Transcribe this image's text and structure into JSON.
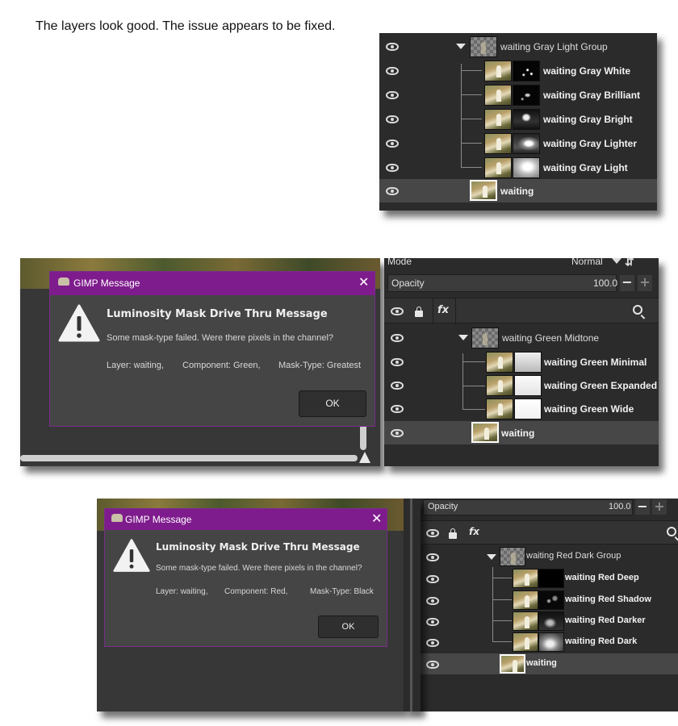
{
  "caption": "The layers look good. The issue appears to be fixed.",
  "panel1": {
    "layers": [
      {
        "name": "waiting Gray Light Group"
      },
      {
        "name": "waiting Gray White"
      },
      {
        "name": "waiting Gray Brilliant"
      },
      {
        "name": "waiting Gray Bright"
      },
      {
        "name": "waiting Gray Lighter"
      },
      {
        "name": "waiting Gray Light"
      },
      {
        "name": "waiting"
      }
    ]
  },
  "panel2": {
    "mode_label": "Mode",
    "mode_value": "Normal",
    "opacity_label": "Opacity",
    "opacity_value": "100.0",
    "fx_label": "fx",
    "layers": [
      {
        "name": "waiting Green Midtone"
      },
      {
        "name": "waiting Green Minimal"
      },
      {
        "name": "waiting Green Expanded"
      },
      {
        "name": "waiting Green Wide"
      },
      {
        "name": "waiting"
      }
    ]
  },
  "dialog1": {
    "title": "GIMP Message",
    "heading": "Luminosity Mask Drive Thru Message",
    "message": "Some mask-type failed. Were there pixels in the channel?",
    "layer": "Layer: waiting,",
    "component": "Component: Green,",
    "mask_type": "Mask-Type: Greatest",
    "ok_label": "OK"
  },
  "panel3": {
    "opacity_label": "Opacity",
    "opacity_value": "100.0",
    "fx_label": "fx",
    "layers": [
      {
        "name": "waiting Red Dark Group"
      },
      {
        "name": "waiting Red Deep"
      },
      {
        "name": "waiting Red Shadow"
      },
      {
        "name": "waiting Red Darker"
      },
      {
        "name": "waiting Red Dark"
      },
      {
        "name": "waiting"
      }
    ]
  },
  "dialog2": {
    "title": "GIMP Message",
    "heading": "Luminosity Mask Drive Thru Message",
    "message": "Some mask-type failed. Were there pixels in the channel?",
    "layer": "Layer: waiting,",
    "component": "Component: Red,",
    "mask_type": "Mask-Type: Black",
    "ok_label": "OK"
  },
  "icons": {
    "visibility": "eye-icon",
    "expand": "triangle-down-icon",
    "warning": "warning-icon",
    "close": "close-icon",
    "lock": "lock-icon",
    "effects": "fx-icon",
    "search": "search-icon"
  }
}
